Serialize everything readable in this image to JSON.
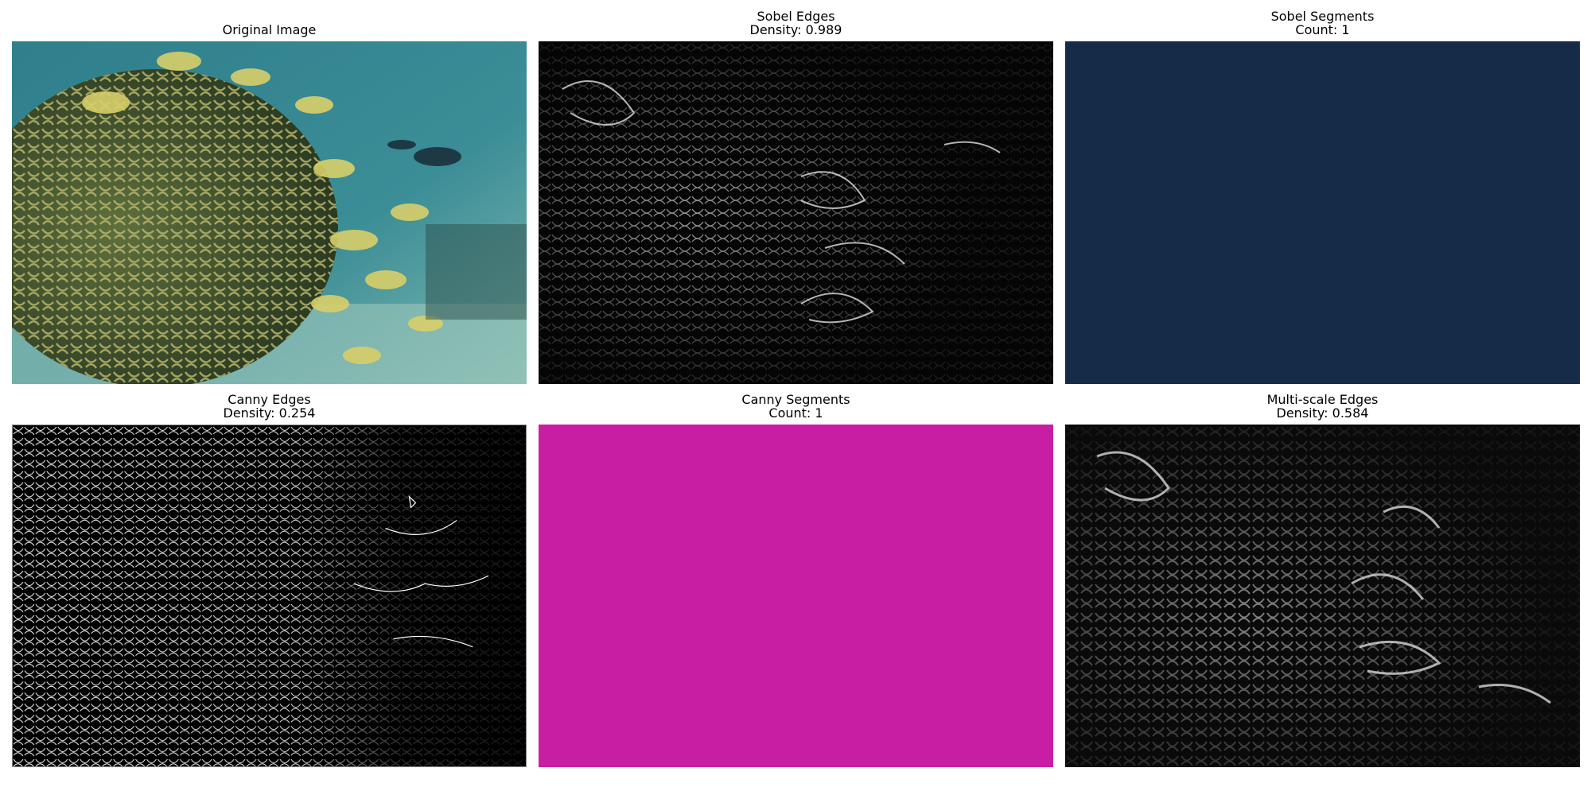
{
  "panels": [
    {
      "title": "Original Image",
      "subtitle": ""
    },
    {
      "title": "Sobel Edges",
      "subtitle": "Density: 0.989"
    },
    {
      "title": "Sobel Segments",
      "subtitle": "Count: 1",
      "fill": "#162b48"
    },
    {
      "title": "Canny Edges",
      "subtitle": "Density: 0.254"
    },
    {
      "title": "Canny Segments",
      "subtitle": "Count: 1",
      "fill": "#c81ea4"
    },
    {
      "title": "Multi-scale Edges",
      "subtitle": "Density: 0.584"
    }
  ],
  "colors": {
    "background": "#ffffff",
    "sobel_segments_fill": "#162b48",
    "canny_segments_fill": "#c81ea4"
  }
}
